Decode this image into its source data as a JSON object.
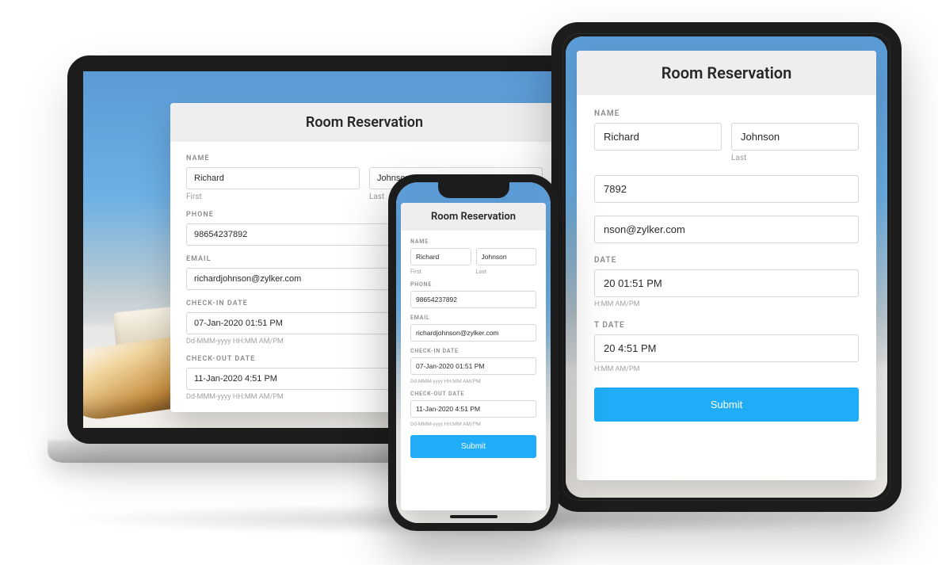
{
  "form": {
    "title": "Room Reservation",
    "labels": {
      "name": "NAME",
      "first_sub": "First",
      "last_sub": "Last",
      "phone": "PHONE",
      "email": "EMAIL",
      "checkin": "CHECK-IN DATE",
      "checkout": "CHECK-OUT DATE"
    },
    "values": {
      "first_name": "Richard",
      "last_name": "Johnson",
      "phone": "98654237892",
      "email": "richardjohnson@zylker.com",
      "checkin": "07-Jan-2020 01:51 PM",
      "checkout": "11-Jan-2020 4:51 PM"
    },
    "tablet_partial": {
      "phone_suffix": "7892",
      "email_suffix": "nson@zylker.com",
      "checkin_label_partial": "DATE",
      "checkin_suffix": "20 01:51 PM",
      "checkout_label_partial": "T DATE",
      "checkout_suffix": "20 4:51 PM"
    },
    "hint": "Dd-MMM-yyyy HH:MM AM/PM",
    "submit": "Submit"
  }
}
